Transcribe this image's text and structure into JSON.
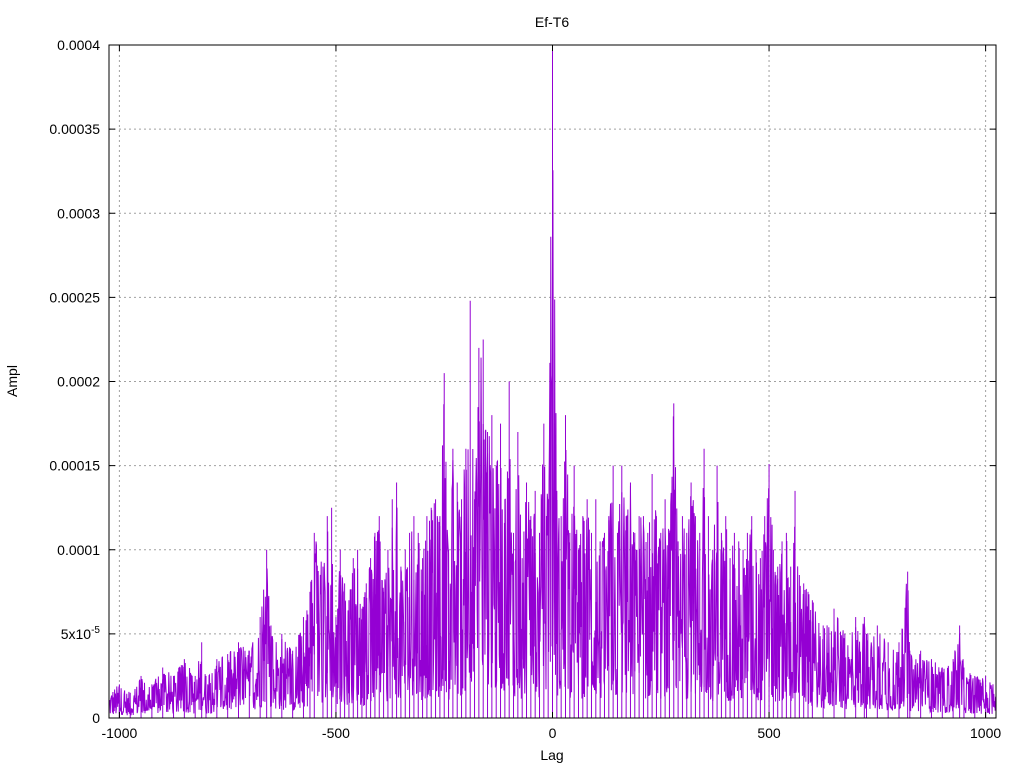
{
  "chart_data": {
    "type": "line",
    "title": "Ef-T6",
    "xlabel": "Lag",
    "ylabel": "Ampl",
    "xlim": [
      -1024,
      1024
    ],
    "ylim": [
      0,
      0.0004
    ],
    "x_ticks": [
      -1000,
      -500,
      0,
      500,
      1000
    ],
    "x_tick_labels": [
      "-1000",
      "-500",
      "0",
      "500",
      "1000"
    ],
    "y_ticks": [
      0,
      5e-05,
      0.0001,
      0.00015,
      0.0002,
      0.00025,
      0.0003,
      0.00035,
      0.0004
    ],
    "y_tick_labels": [
      "0",
      "5x10-5",
      "0.0001",
      "0.00015",
      "0.0002",
      "0.00025",
      "0.0003",
      "0.00035",
      "0.0004"
    ],
    "grid": true,
    "line_color": "#9400d3",
    "series": [
      {
        "x": [
          -1024,
          -1000,
          -975,
          -950,
          -925,
          -900,
          -875,
          -850,
          -825,
          -810,
          -800,
          -775,
          -750,
          -725,
          -700,
          -675,
          -660,
          -650,
          -625,
          -600,
          -575,
          -560,
          -550,
          -530,
          -520,
          -510,
          -500,
          -490,
          -480,
          -470,
          -460,
          -450,
          -440,
          -430,
          -420,
          -410,
          -400,
          -390,
          -380,
          -370,
          -360,
          -350,
          -340,
          -330,
          -320,
          -310,
          -300,
          -290,
          -280,
          -270,
          -260,
          -250,
          -240,
          -230,
          -220,
          -210,
          -200,
          -190,
          -180,
          -170,
          -160,
          -150,
          -140,
          -130,
          -120,
          -110,
          -100,
          -90,
          -80,
          -70,
          -60,
          -50,
          -40,
          -30,
          -20,
          -10,
          0,
          10,
          20,
          30,
          40,
          50,
          60,
          70,
          80,
          90,
          100,
          110,
          120,
          130,
          140,
          150,
          160,
          170,
          180,
          190,
          200,
          210,
          220,
          230,
          240,
          250,
          260,
          270,
          280,
          290,
          300,
          310,
          320,
          330,
          340,
          350,
          360,
          370,
          380,
          390,
          400,
          410,
          420,
          430,
          440,
          450,
          460,
          470,
          480,
          490,
          500,
          510,
          520,
          530,
          540,
          550,
          560,
          570,
          580,
          590,
          600,
          625,
          650,
          675,
          700,
          720,
          725,
          750,
          775,
          800,
          820,
          825,
          850,
          875,
          900,
          925,
          940,
          950,
          975,
          1000,
          1024
        ],
        "y": [
          1.8e-05,
          2e-05,
          1.5e-05,
          2.5e-05,
          2e-05,
          3e-05,
          2.5e-05,
          3.5e-05,
          2.5e-05,
          4.5e-05,
          2.5e-05,
          3.5e-05,
          3.8e-05,
          4.5e-05,
          4e-05,
          6e-05,
          0.0001,
          5.5e-05,
          5e-05,
          4e-05,
          6e-05,
          7.5e-05,
          0.00011,
          9e-05,
          0.00012,
          0.000125,
          6e-05,
          0.0001,
          8e-05,
          7e-05,
          9.5e-05,
          0.0001,
          6.5e-05,
          8e-05,
          9.5e-05,
          0.00011,
          0.00012,
          7.5e-05,
          0.0001,
          0.00013,
          0.00014,
          9e-05,
          0.0001,
          0.00011,
          0.00012,
          0.00011,
          9.5e-05,
          0.00012,
          0.000125,
          0.00013,
          0.00012,
          0.000205,
          0.0001,
          0.00016,
          0.00014,
          0.00013,
          0.00016,
          0.000248,
          0.00013,
          0.00022,
          0.000225,
          0.00017,
          0.00018,
          0.00015,
          0.000175,
          0.00013,
          0.0002,
          0.00011,
          0.00017,
          9.5e-05,
          0.00014,
          0.00012,
          0.000135,
          0.00011,
          0.000175,
          0.00013,
          0.0004,
          0.000135,
          0.00012,
          0.00018,
          0.00011,
          0.00015,
          0.0001,
          0.00012,
          0.00013,
          0.00011,
          0.00013,
          0.000105,
          0.00011,
          0.00012,
          0.00015,
          0.00011,
          0.00015,
          0.00012,
          0.00014,
          0.00011,
          0.00012,
          0.00012,
          0.00011,
          0.000145,
          0.00012,
          0.00011,
          0.00013,
          0.00011,
          0.000187,
          0.000105,
          0.00012,
          0.00011,
          0.00014,
          0.00012,
          0.00011,
          0.00016,
          0.00012,
          0.0001,
          0.00015,
          0.00011,
          0.00012,
          9.5e-05,
          0.00011,
          0.000105,
          0.0001,
          0.00011,
          0.00012,
          0.0001,
          9.5e-05,
          0.00012,
          0.000151,
          0.0001,
          9e-05,
          0.000105,
          0.00011,
          9e-05,
          0.000135,
          8.5e-05,
          8e-05,
          7.5e-05,
          7e-05,
          5.5e-05,
          6.5e-05,
          5e-05,
          6e-05,
          6e-05,
          5e-05,
          5.5e-05,
          4.5e-05,
          4.5e-05,
          8.7e-05,
          4e-05,
          4e-05,
          3.5e-05,
          3e-05,
          3.5e-05,
          5.5e-05,
          3e-05,
          2.5e-05,
          2.5e-05,
          2e-05
        ]
      }
    ]
  }
}
